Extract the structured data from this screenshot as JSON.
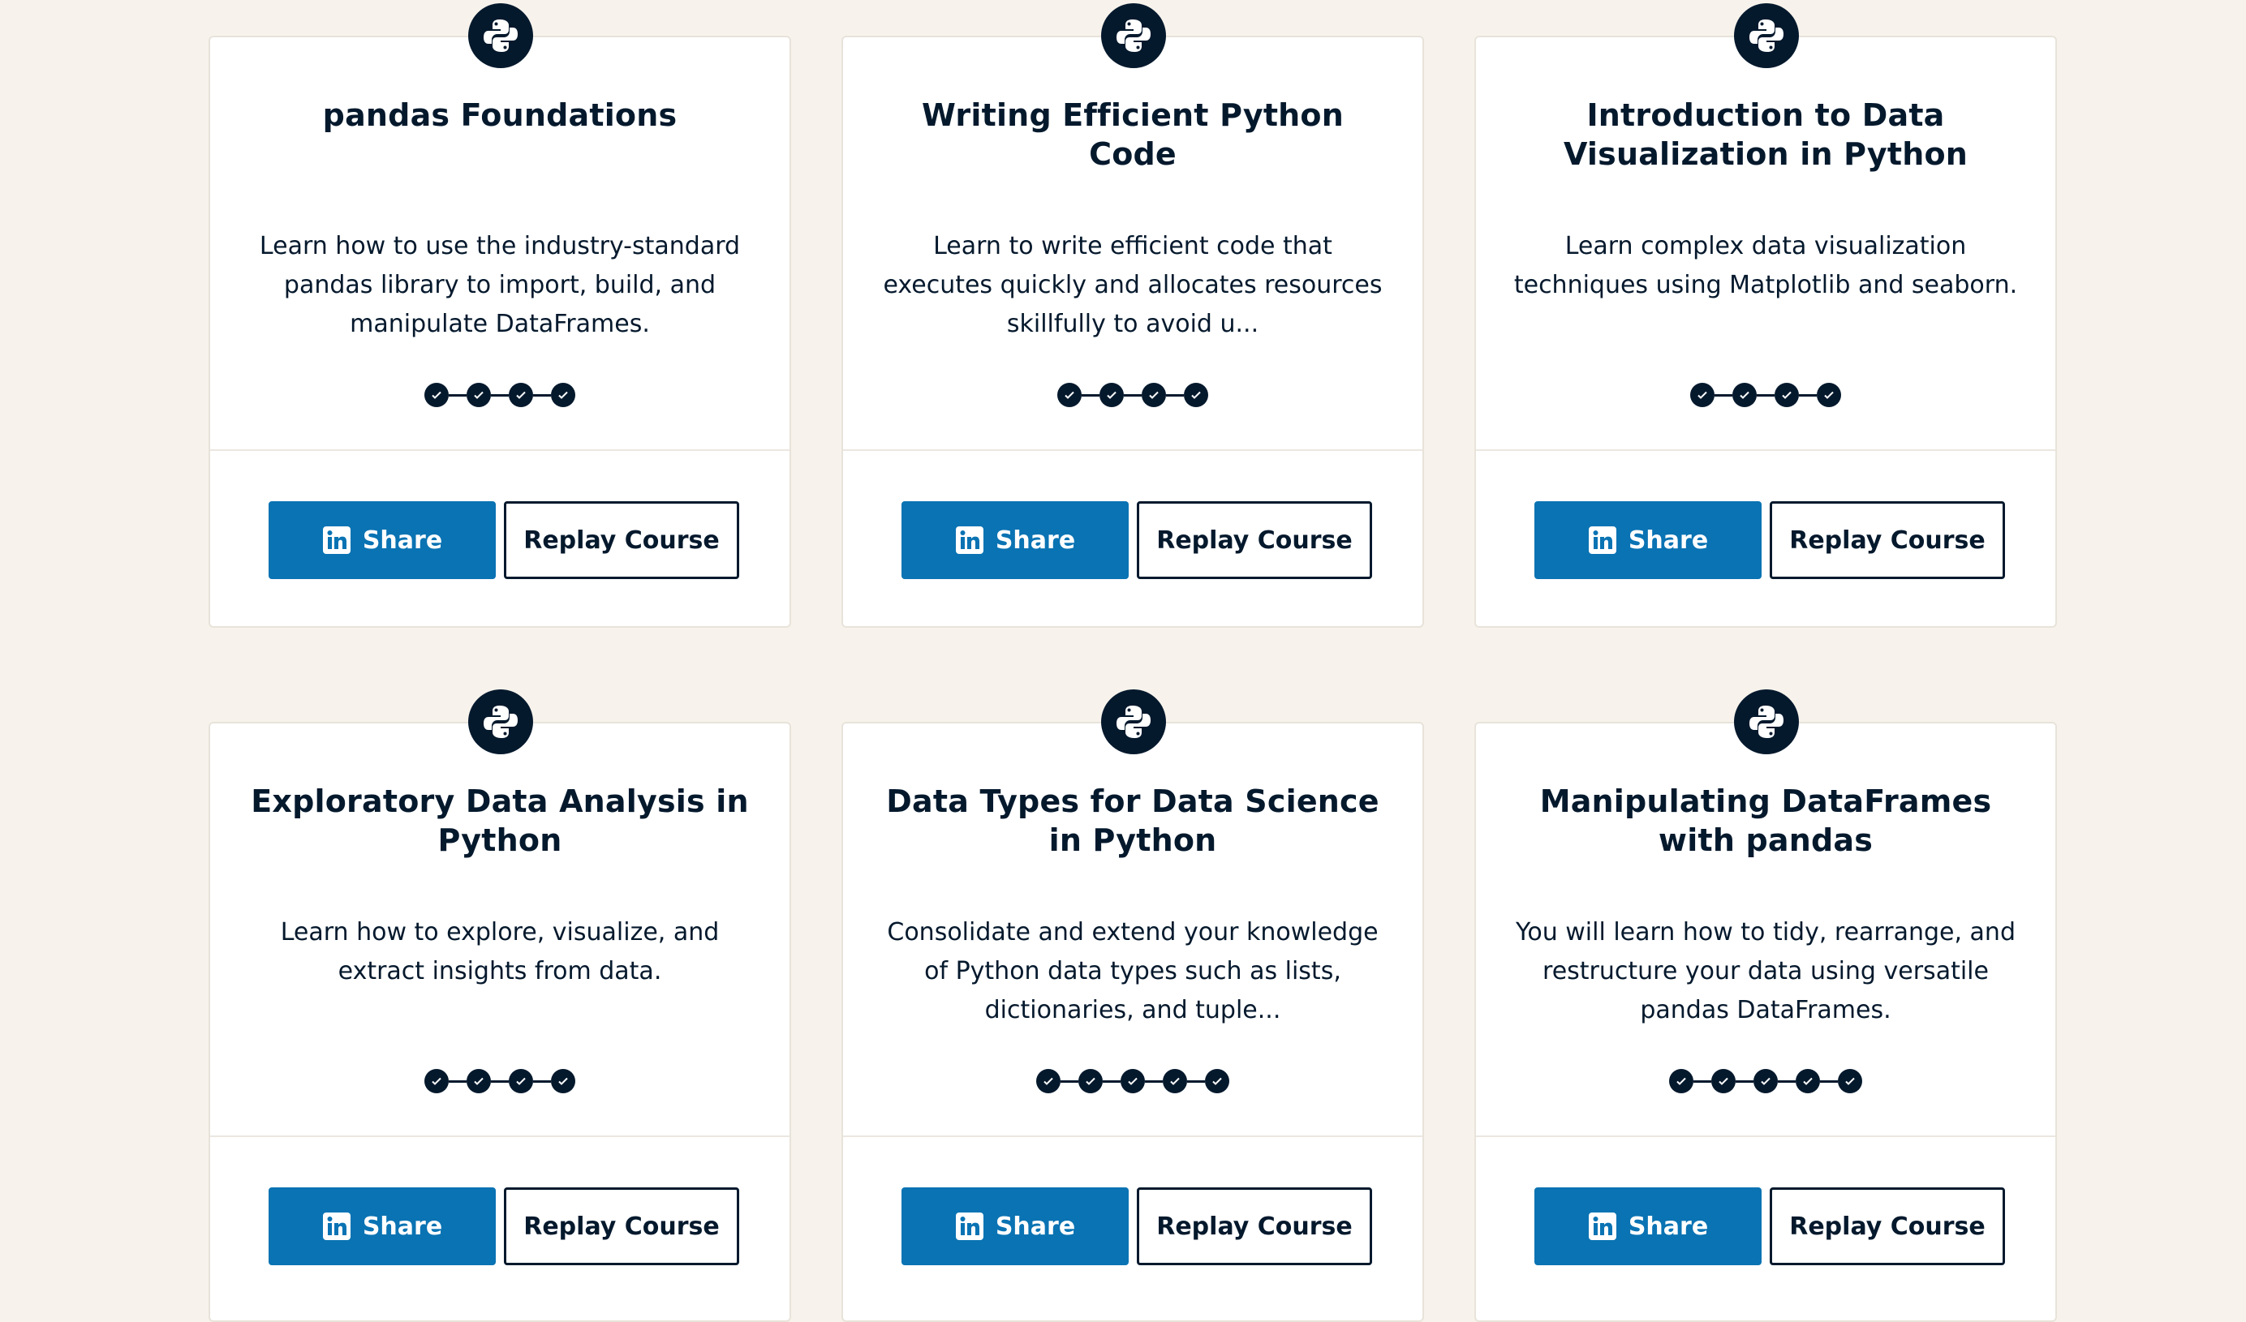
{
  "courses": [
    {
      "title": "pandas Foundations",
      "description": "Learn how to use the industry-standard pandas library to import, build, and manipulate DataFrames.",
      "chapters_completed": 4,
      "share_label": "Share",
      "replay_label": "Replay Course"
    },
    {
      "title": "Writing Efficient Python Code",
      "description": "Learn to write efficient code that executes quickly and allocates resources skillfully to avoid u...",
      "chapters_completed": 4,
      "share_label": "Share",
      "replay_label": "Replay Course"
    },
    {
      "title": "Introduction to Data Visualization in Python",
      "description": "Learn complex data visualization techniques using Matplotlib and seaborn.",
      "chapters_completed": 4,
      "share_label": "Share",
      "replay_label": "Replay Course"
    },
    {
      "title": "Exploratory Data Analysis in Python",
      "description": "Learn how to explore, visualize, and extract insights from data.",
      "chapters_completed": 4,
      "share_label": "Share",
      "replay_label": "Replay Course"
    },
    {
      "title": "Data Types for Data Science in Python",
      "description": "Consolidate and extend your knowledge of Python data types such as lists, dictionaries, and tuple...",
      "chapters_completed": 5,
      "share_label": "Share",
      "replay_label": "Replay Course"
    },
    {
      "title": "Manipulating DataFrames with pandas",
      "description": "You will learn how to tidy, rearrange, and restructure your data using versatile pandas DataFrames.",
      "chapters_completed": 5,
      "share_label": "Share",
      "replay_label": "Replay Course"
    }
  ],
  "icons": {
    "badge": "python-icon",
    "share": "linkedin-icon",
    "step": "check-icon"
  },
  "colors": {
    "page_background": "#f7f3ec",
    "navy": "#05192d",
    "linkedin_blue": "#0a73b3",
    "card_border": "#e8e3da"
  }
}
